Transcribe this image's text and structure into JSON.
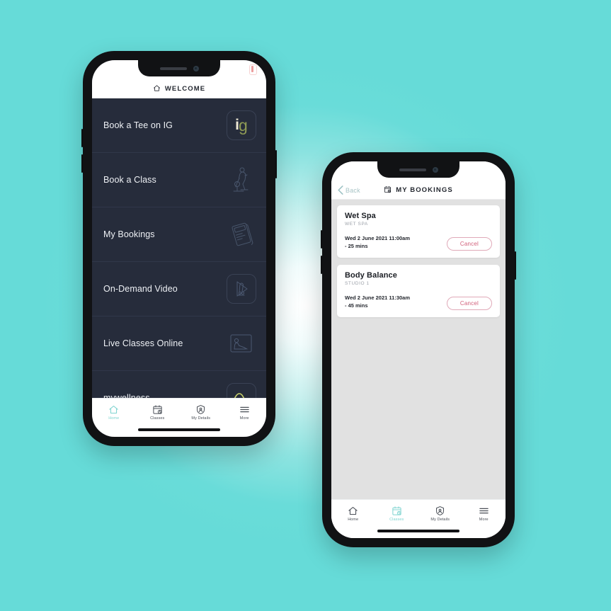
{
  "background": {
    "accent_teal": "#66dbd8",
    "center_glow": "#ffffff"
  },
  "phone_left": {
    "header": {
      "title": "WELCOME",
      "icon": "home-icon"
    },
    "menu": [
      {
        "label": "Book a Tee on IG",
        "icon": "ig-logo-tile"
      },
      {
        "label": "Book a Class",
        "icon": "exercise-bike-icon"
      },
      {
        "label": "My Bookings",
        "icon": "notebook-icon"
      },
      {
        "label": "On-Demand Video",
        "icon": "video-play-icon"
      },
      {
        "label": "Live Classes Online",
        "icon": "live-stream-icon"
      },
      {
        "label": "mywellness",
        "icon": "mywellness-curve-icon"
      }
    ],
    "ig_logo": {
      "first": "i",
      "second": "g",
      "color_i": "#f0ead6",
      "color_g": "#8f9b55"
    },
    "tabbar": [
      {
        "label": "Home",
        "icon": "home-icon",
        "active": true
      },
      {
        "label": "Classes",
        "icon": "calendar-clock-icon",
        "active": false
      },
      {
        "label": "My Details",
        "icon": "shield-id-icon",
        "active": false
      },
      {
        "label": "More",
        "icon": "hamburger-menu-icon",
        "active": false
      }
    ],
    "active_color": "#7fd4d0"
  },
  "phone_right": {
    "header": {
      "back_label": "Back",
      "title": "MY BOOKINGS",
      "icon": "calendar-clock-icon"
    },
    "bookings": [
      {
        "title": "Wet Spa",
        "location": "WET SPA",
        "when": "Wed 2 June 2021 11:00am",
        "duration": "- 25 mins",
        "action": "Cancel"
      },
      {
        "title": "Body Balance",
        "location": "STUDIO 1",
        "when": "Wed 2 June 2021 11:30am",
        "duration": "- 45 mins",
        "action": "Cancel"
      }
    ],
    "cancel_color": "#d2607b",
    "tabbar": [
      {
        "label": "Home",
        "icon": "home-icon",
        "active": false
      },
      {
        "label": "Classes",
        "icon": "calendar-clock-icon",
        "active": true
      },
      {
        "label": "My Details",
        "icon": "shield-id-icon",
        "active": false
      },
      {
        "label": "More",
        "icon": "hamburger-menu-icon",
        "active": false
      }
    ],
    "active_color": "#7fd4d0"
  }
}
